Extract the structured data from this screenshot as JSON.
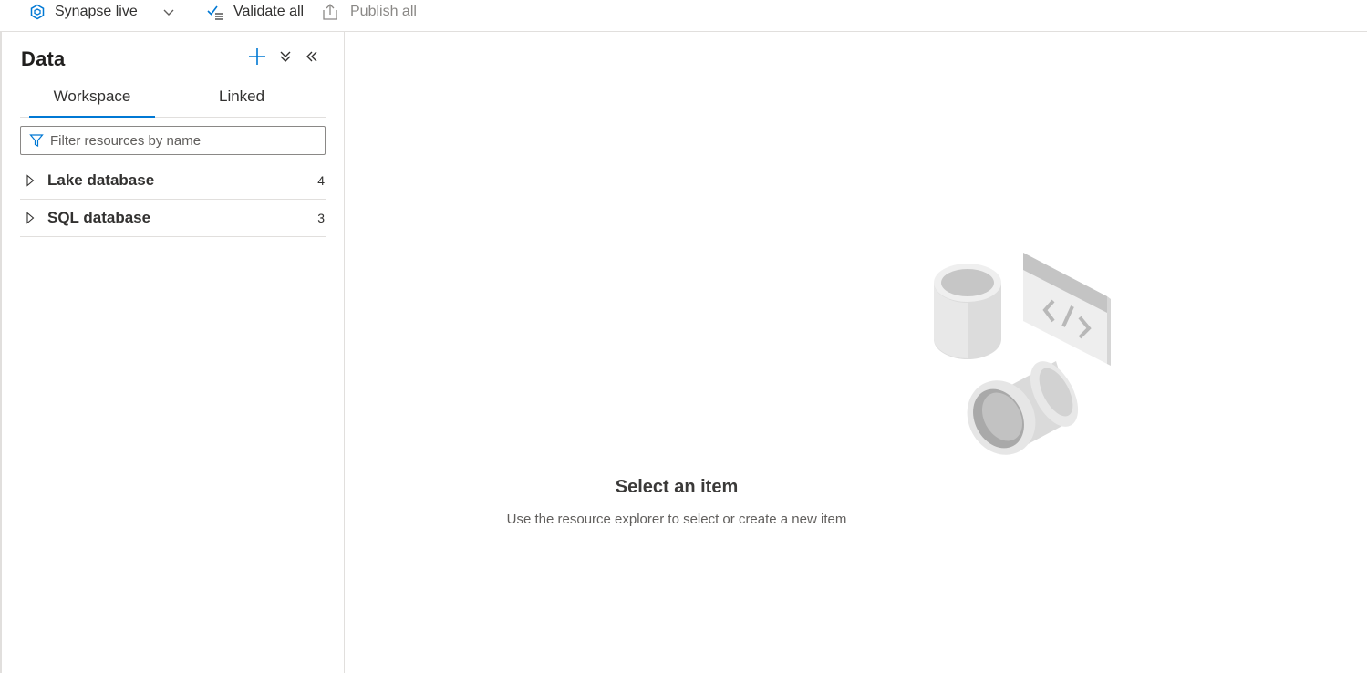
{
  "toolbar": {
    "mode_label": "Synapse live",
    "validate_label": "Validate all",
    "publish_label": "Publish all"
  },
  "panel": {
    "title": "Data",
    "tabs": [
      {
        "label": "Workspace",
        "selected": true
      },
      {
        "label": "Linked",
        "selected": false
      }
    ],
    "filter_placeholder": "Filter resources by name",
    "items": [
      {
        "label": "Lake database",
        "count": "4"
      },
      {
        "label": "SQL database",
        "count": "3"
      }
    ]
  },
  "empty_state": {
    "title": "Select an item",
    "subtitle": "Use the resource explorer to select or create a new item"
  },
  "colors": {
    "accent": "#0078d4",
    "border": "#e1dfdd",
    "text": "#323130",
    "muted": "#8a8886"
  }
}
